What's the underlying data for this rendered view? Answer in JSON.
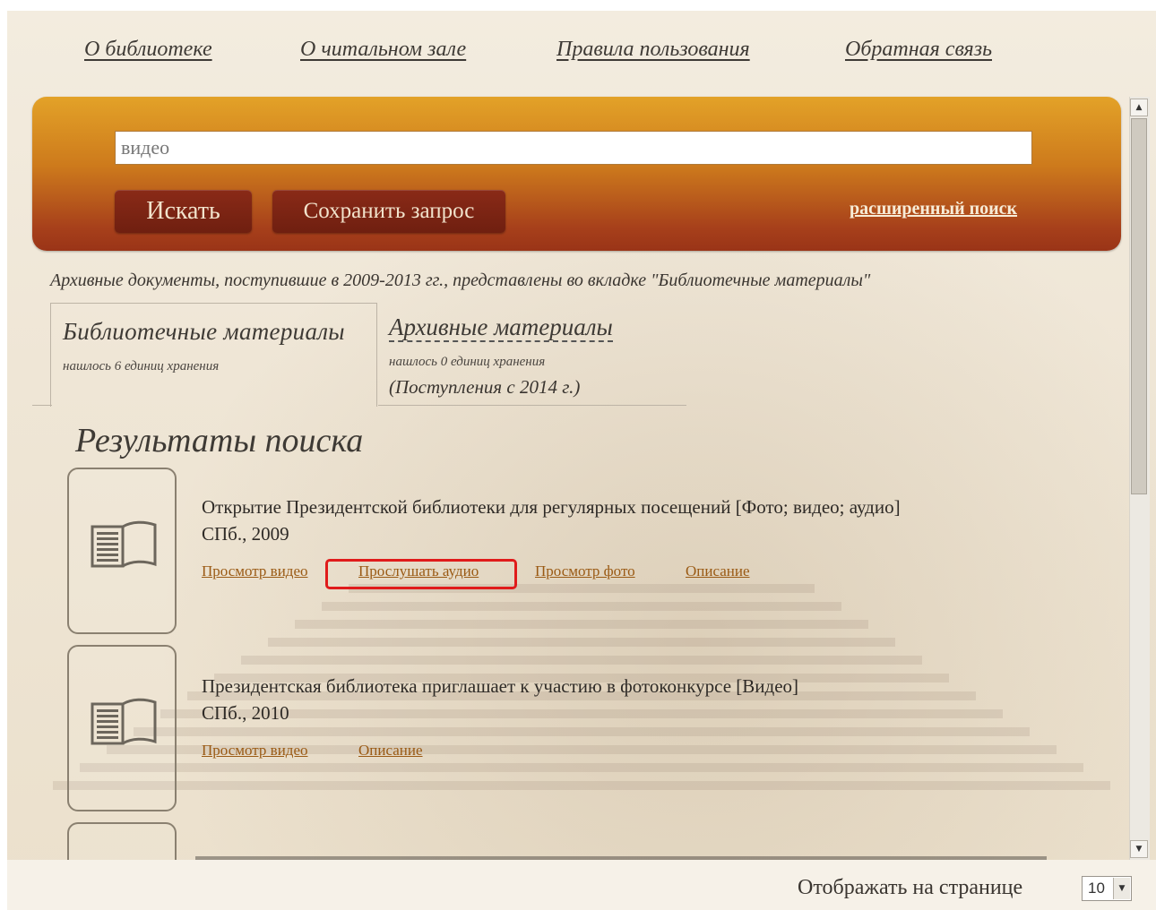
{
  "nav": {
    "about": "О библиотеке",
    "reading_room": "О читальном зале",
    "rules": "Правила пользования",
    "feedback": "Обратная связь"
  },
  "search": {
    "query": "видео",
    "search_button": "Искать",
    "save_button": "Сохранить запрос",
    "advanced_link": "расширенный поиск"
  },
  "archive_note": "Архивные документы, поступившие в 2009-2013 гг., представлены во вкладке \"Библиотечные материалы\"",
  "tabs": [
    {
      "title": "Библиотечные материалы",
      "count": "нашлось 6 единиц хранения",
      "note": ""
    },
    {
      "title": "Архивные материалы",
      "count": "нашлось 0 единиц хранения",
      "note": "(Поступления с 2014 г.)"
    }
  ],
  "results_title": "Результаты поиска",
  "results": [
    {
      "title": "Открытие Президентской библиотеки для регулярных посещений [Фото; видео; аудио]",
      "publication": "СПб., 2009",
      "links": [
        "Просмотр видео",
        "Прослушать аудио",
        "Просмотр фото",
        "Описание"
      ]
    },
    {
      "title": "Президентская библиотека приглашает к участию в фотоконкурсе [Видео]",
      "publication": "СПб., 2010",
      "links": [
        "Просмотр видео",
        "Описание"
      ]
    }
  ],
  "pagination": {
    "per_page_label": "Отображать на странице",
    "per_page_value": "10"
  },
  "icons": {
    "book": "book-icon",
    "scroll_up": "arrow-up-icon",
    "scroll_down": "arrow-down-icon",
    "dropdown": "chevron-down-icon"
  },
  "colors": {
    "panel_top": "#e3a228",
    "panel_bottom": "#9a3417",
    "button": "#7a2412",
    "link": "#9a5a14",
    "highlight": "#e01b1b"
  }
}
